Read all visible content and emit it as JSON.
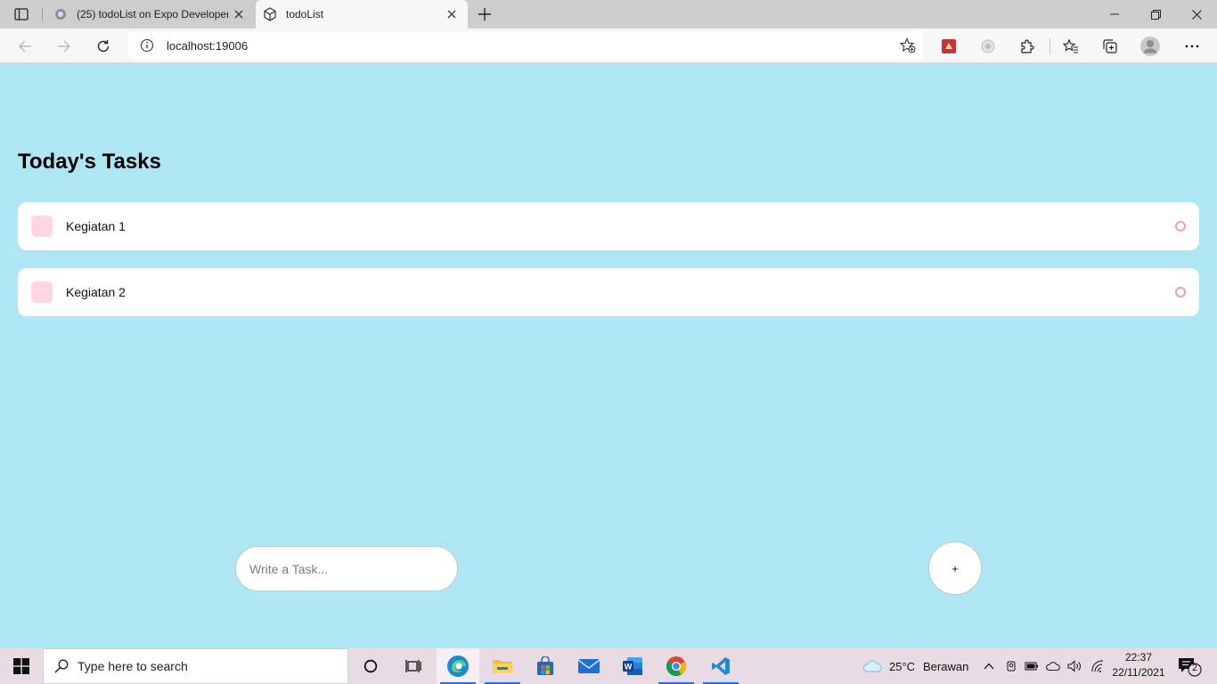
{
  "browser": {
    "tabs": [
      {
        "title": "(25) todoList on Expo Developer",
        "active": false
      },
      {
        "title": "todoList",
        "active": true
      }
    ],
    "url": "localhost:19006"
  },
  "app": {
    "heading": "Today's Tasks",
    "tasks": [
      {
        "text": "Kegiatan 1"
      },
      {
        "text": "Kegiatan 2"
      }
    ],
    "input_placeholder": "Write a Task...",
    "add_button_label": "+"
  },
  "taskbar": {
    "search_placeholder": "Type here to search",
    "weather": {
      "temp": "25°C",
      "condition": "Berawan"
    },
    "time": "22:37",
    "date": "22/11/2021",
    "notification_count": "2"
  },
  "colors": {
    "background": "#aee7f3",
    "task_square": "#ffd6e1",
    "task_circle": "#f59ab5"
  }
}
